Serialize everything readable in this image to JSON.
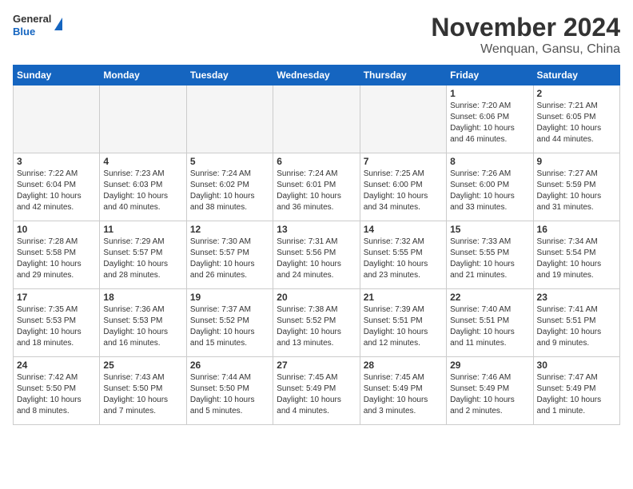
{
  "header": {
    "logo_general": "General",
    "logo_blue": "Blue",
    "month": "November 2024",
    "location": "Wenquan, Gansu, China"
  },
  "weekdays": [
    "Sunday",
    "Monday",
    "Tuesday",
    "Wednesday",
    "Thursday",
    "Friday",
    "Saturday"
  ],
  "weeks": [
    [
      {
        "day": "",
        "info": "",
        "empty": true
      },
      {
        "day": "",
        "info": "",
        "empty": true
      },
      {
        "day": "",
        "info": "",
        "empty": true
      },
      {
        "day": "",
        "info": "",
        "empty": true
      },
      {
        "day": "",
        "info": "",
        "empty": true
      },
      {
        "day": "1",
        "info": "Sunrise: 7:20 AM\nSunset: 6:06 PM\nDaylight: 10 hours\nand 46 minutes."
      },
      {
        "day": "2",
        "info": "Sunrise: 7:21 AM\nSunset: 6:05 PM\nDaylight: 10 hours\nand 44 minutes."
      }
    ],
    [
      {
        "day": "3",
        "info": "Sunrise: 7:22 AM\nSunset: 6:04 PM\nDaylight: 10 hours\nand 42 minutes."
      },
      {
        "day": "4",
        "info": "Sunrise: 7:23 AM\nSunset: 6:03 PM\nDaylight: 10 hours\nand 40 minutes."
      },
      {
        "day": "5",
        "info": "Sunrise: 7:24 AM\nSunset: 6:02 PM\nDaylight: 10 hours\nand 38 minutes."
      },
      {
        "day": "6",
        "info": "Sunrise: 7:24 AM\nSunset: 6:01 PM\nDaylight: 10 hours\nand 36 minutes."
      },
      {
        "day": "7",
        "info": "Sunrise: 7:25 AM\nSunset: 6:00 PM\nDaylight: 10 hours\nand 34 minutes."
      },
      {
        "day": "8",
        "info": "Sunrise: 7:26 AM\nSunset: 6:00 PM\nDaylight: 10 hours\nand 33 minutes."
      },
      {
        "day": "9",
        "info": "Sunrise: 7:27 AM\nSunset: 5:59 PM\nDaylight: 10 hours\nand 31 minutes."
      }
    ],
    [
      {
        "day": "10",
        "info": "Sunrise: 7:28 AM\nSunset: 5:58 PM\nDaylight: 10 hours\nand 29 minutes."
      },
      {
        "day": "11",
        "info": "Sunrise: 7:29 AM\nSunset: 5:57 PM\nDaylight: 10 hours\nand 28 minutes."
      },
      {
        "day": "12",
        "info": "Sunrise: 7:30 AM\nSunset: 5:57 PM\nDaylight: 10 hours\nand 26 minutes."
      },
      {
        "day": "13",
        "info": "Sunrise: 7:31 AM\nSunset: 5:56 PM\nDaylight: 10 hours\nand 24 minutes."
      },
      {
        "day": "14",
        "info": "Sunrise: 7:32 AM\nSunset: 5:55 PM\nDaylight: 10 hours\nand 23 minutes."
      },
      {
        "day": "15",
        "info": "Sunrise: 7:33 AM\nSunset: 5:55 PM\nDaylight: 10 hours\nand 21 minutes."
      },
      {
        "day": "16",
        "info": "Sunrise: 7:34 AM\nSunset: 5:54 PM\nDaylight: 10 hours\nand 19 minutes."
      }
    ],
    [
      {
        "day": "17",
        "info": "Sunrise: 7:35 AM\nSunset: 5:53 PM\nDaylight: 10 hours\nand 18 minutes."
      },
      {
        "day": "18",
        "info": "Sunrise: 7:36 AM\nSunset: 5:53 PM\nDaylight: 10 hours\nand 16 minutes."
      },
      {
        "day": "19",
        "info": "Sunrise: 7:37 AM\nSunset: 5:52 PM\nDaylight: 10 hours\nand 15 minutes."
      },
      {
        "day": "20",
        "info": "Sunrise: 7:38 AM\nSunset: 5:52 PM\nDaylight: 10 hours\nand 13 minutes."
      },
      {
        "day": "21",
        "info": "Sunrise: 7:39 AM\nSunset: 5:51 PM\nDaylight: 10 hours\nand 12 minutes."
      },
      {
        "day": "22",
        "info": "Sunrise: 7:40 AM\nSunset: 5:51 PM\nDaylight: 10 hours\nand 11 minutes."
      },
      {
        "day": "23",
        "info": "Sunrise: 7:41 AM\nSunset: 5:51 PM\nDaylight: 10 hours\nand 9 minutes."
      }
    ],
    [
      {
        "day": "24",
        "info": "Sunrise: 7:42 AM\nSunset: 5:50 PM\nDaylight: 10 hours\nand 8 minutes."
      },
      {
        "day": "25",
        "info": "Sunrise: 7:43 AM\nSunset: 5:50 PM\nDaylight: 10 hours\nand 7 minutes."
      },
      {
        "day": "26",
        "info": "Sunrise: 7:44 AM\nSunset: 5:50 PM\nDaylight: 10 hours\nand 5 minutes."
      },
      {
        "day": "27",
        "info": "Sunrise: 7:45 AM\nSunset: 5:49 PM\nDaylight: 10 hours\nand 4 minutes."
      },
      {
        "day": "28",
        "info": "Sunrise: 7:45 AM\nSunset: 5:49 PM\nDaylight: 10 hours\nand 3 minutes."
      },
      {
        "day": "29",
        "info": "Sunrise: 7:46 AM\nSunset: 5:49 PM\nDaylight: 10 hours\nand 2 minutes."
      },
      {
        "day": "30",
        "info": "Sunrise: 7:47 AM\nSunset: 5:49 PM\nDaylight: 10 hours\nand 1 minute."
      }
    ]
  ]
}
